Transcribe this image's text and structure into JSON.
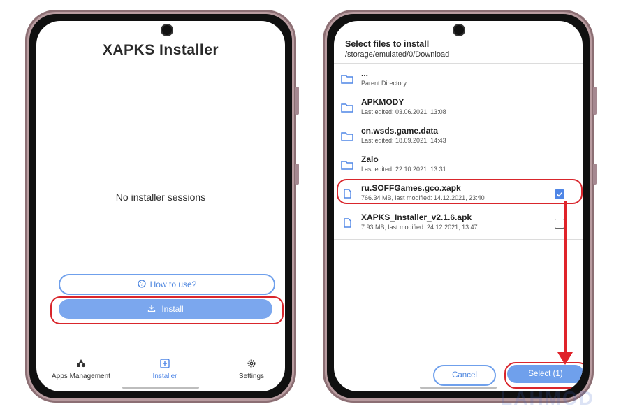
{
  "phone1": {
    "title": "XAPKS Installer",
    "empty_message": "No installer sessions",
    "how_to_label": "How to use?",
    "install_label": "Install",
    "nav": [
      {
        "label": "Apps Management",
        "icon": "shapes-icon"
      },
      {
        "label": "Installer",
        "icon": "installer-icon"
      },
      {
        "label": "Settings",
        "icon": "gear-icon"
      }
    ]
  },
  "phone2": {
    "dialog_title": "Select files to install",
    "dialog_path": "/storage/emulated/0/Download",
    "entries": [
      {
        "name": "...",
        "meta": "Parent Directory",
        "type": "folder"
      },
      {
        "name": "APKMODY",
        "meta": "Last edited: 03.06.2021, 13:08",
        "type": "folder"
      },
      {
        "name": "cn.wsds.game.data",
        "meta": "Last edited: 18.09.2021, 14:43",
        "type": "folder"
      },
      {
        "name": "Zalo",
        "meta": "Last edited: 22.10.2021, 13:31",
        "type": "folder"
      },
      {
        "name": "ru.SOFFGames.gco.xapk",
        "meta": "766.34 MB, last modified: 14.12.2021, 23:40",
        "type": "file",
        "checked": true
      },
      {
        "name": "XAPKS_Installer_v2.1.6.apk",
        "meta": "7.93 MB, last modified: 24.12.2021, 13:47",
        "type": "file",
        "checked": false
      }
    ],
    "cancel_label": "Cancel",
    "select_label": "Select (1)"
  },
  "watermark": "LAHMOD",
  "colors": {
    "accent": "#7ba7ee",
    "highlight": "#d9262c",
    "folder": "#4f86e6"
  }
}
